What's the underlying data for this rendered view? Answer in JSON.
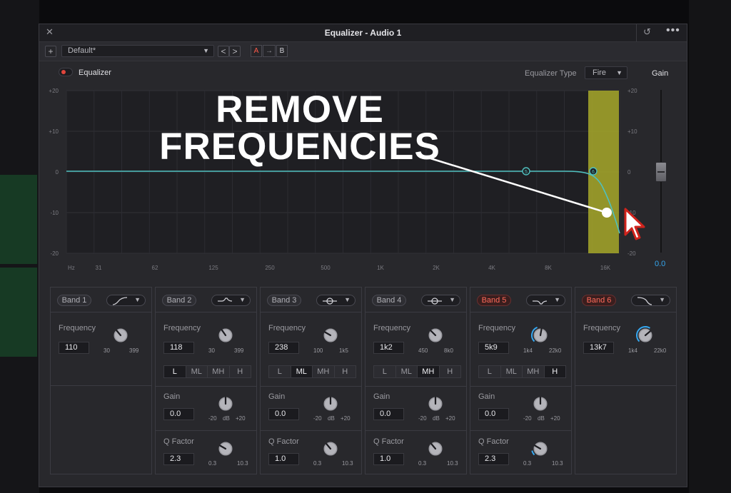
{
  "window": {
    "title": "Equalizer - Audio 1"
  },
  "toolbar": {
    "add": "+",
    "preset": "Default*",
    "prev": "<",
    "next": ">",
    "a_label": "A",
    "arrow_label": "→",
    "b_label": "B"
  },
  "header": {
    "eq_label": "Equalizer",
    "eq_type_label": "Equalizer Type",
    "eq_type_value": "Fire",
    "gain_label": "Gain",
    "gain_value": "0.0"
  },
  "graph": {
    "y_ticks_left": [
      "+20",
      "+10",
      "0",
      "-10",
      "-20"
    ],
    "y_ticks_right": [
      "+20",
      "+10",
      "0",
      "-10",
      "-20"
    ],
    "x_ticks": [
      "Hz",
      "31",
      "62",
      "125",
      "250",
      "500",
      "1K",
      "2K",
      "4K",
      "8K",
      "16K"
    ],
    "node_labels": [
      "5",
      "6"
    ],
    "curve_color": "#4fc0bf",
    "highlight_color": "#a8a92a"
  },
  "overlay": {
    "line1": "REMOVE",
    "line2": "FREQUENCIES"
  },
  "labels": {
    "frequency": "Frequency",
    "gain": "Gain",
    "qfactor": "Q Factor",
    "db": "dB",
    "gain_min": "-20",
    "gain_max": "+20",
    "q_min": "0.3",
    "q_max": "10.3",
    "l": "L",
    "ml": "ML",
    "mh": "MH",
    "h": "H"
  },
  "bands": [
    {
      "name": "Band 1",
      "freq": "110",
      "min": "30",
      "max": "399"
    },
    {
      "name": "Band 2",
      "freq": "118",
      "min": "30",
      "max": "399",
      "gain": "0.0",
      "q": "2.3"
    },
    {
      "name": "Band 3",
      "freq": "238",
      "min": "100",
      "max": "1k5",
      "gain": "0.0",
      "q": "1.0"
    },
    {
      "name": "Band 4",
      "freq": "1k2",
      "min": "450",
      "max": "8k0",
      "gain": "0.0",
      "q": "1.0"
    },
    {
      "name": "Band 5",
      "freq": "5k9",
      "min": "1k4",
      "max": "22k0",
      "gain": "0.0",
      "q": "2.3"
    },
    {
      "name": "Band 6",
      "freq": "13k7",
      "min": "1k4",
      "max": "22k0"
    }
  ],
  "active_colors": {
    "band_on": "#ff6a5a",
    "knob_ring": "#35a6ee"
  }
}
